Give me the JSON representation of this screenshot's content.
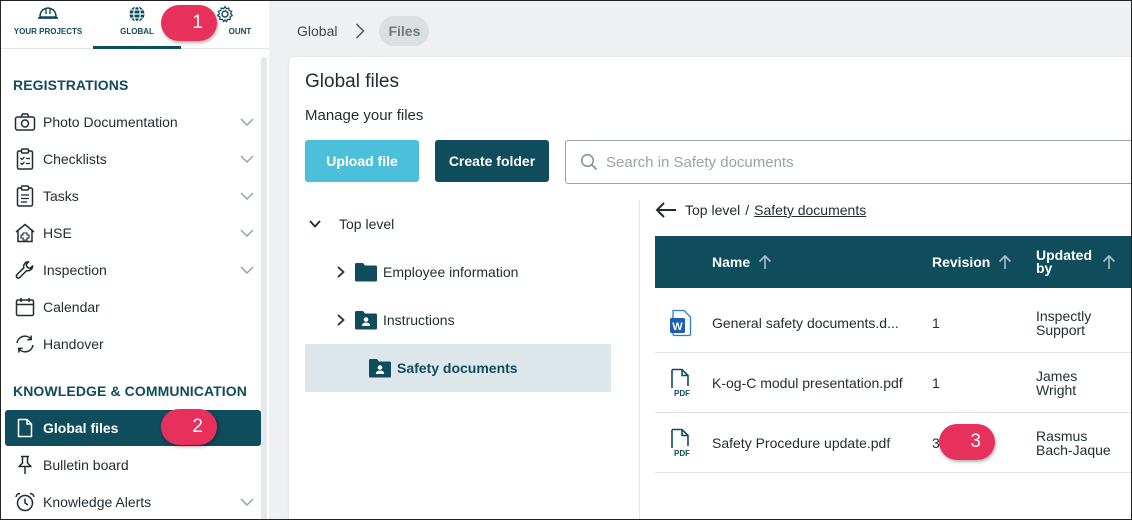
{
  "top_nav": {
    "items": [
      {
        "label": "YOUR PROJECTS",
        "icon": "hard-hat-icon"
      },
      {
        "label": "GLOBAL",
        "icon": "globe-icon",
        "active": true
      },
      {
        "label": "ACCOUNT",
        "icon": "gear-icon",
        "visible_text": "OUNT"
      }
    ]
  },
  "sidebar": {
    "section1_title": "REGISTRATIONS",
    "section1_items": [
      {
        "label": "Photo Documentation",
        "icon": "camera-icon",
        "expandable": true
      },
      {
        "label": "Checklists",
        "icon": "checklist-icon",
        "expandable": true
      },
      {
        "label": "Tasks",
        "icon": "clipboard-icon",
        "expandable": true
      },
      {
        "label": "HSE",
        "icon": "hse-house-icon",
        "expandable": true
      },
      {
        "label": "Inspection",
        "icon": "wrench-icon",
        "expandable": true
      },
      {
        "label": "Calendar",
        "icon": "calendar-icon",
        "expandable": false
      },
      {
        "label": "Handover",
        "icon": "handover-icon",
        "expandable": false
      }
    ],
    "section2_title": "KNOWLEDGE & COMMUNICATION",
    "section2_items": [
      {
        "label": "Global files",
        "icon": "file-icon",
        "active": true
      },
      {
        "label": "Bulletin board",
        "icon": "pin-icon"
      },
      {
        "label": "Knowledge Alerts",
        "icon": "alarm-clock-icon",
        "expandable": true
      }
    ]
  },
  "breadcrumb": {
    "parent": "Global",
    "current": "Files"
  },
  "page": {
    "title": "Global files",
    "subtitle": "Manage your files",
    "upload_label": "Upload file",
    "create_folder_label": "Create folder",
    "search_placeholder": "Search in Safety documents"
  },
  "tree": {
    "root": "Top level",
    "folders": [
      {
        "label": "Employee information",
        "expandable": true
      },
      {
        "label": "Instructions",
        "expandable": true
      },
      {
        "label": "Safety documents",
        "expandable": false,
        "selected": true
      }
    ]
  },
  "path": {
    "root": "Top level",
    "separator": "/",
    "current": "Safety documents"
  },
  "table": {
    "columns": [
      "Name",
      "Revision",
      "Updated by"
    ],
    "header_updated_line1": "Updated",
    "header_updated_line2": "by",
    "rows": [
      {
        "icon": "word-doc-icon",
        "name": "General safety documents.d...",
        "revision": "1",
        "updated_by_1": "Inspectly",
        "updated_by_2": "Support"
      },
      {
        "icon": "pdf-icon",
        "name": "K-og-C modul presentation.pdf",
        "revision": "1",
        "updated_by_1": "James",
        "updated_by_2": "Wright"
      },
      {
        "icon": "pdf-icon",
        "name": "Safety Procedure update.pdf",
        "revision": "3",
        "updated_by_1": "Rasmus",
        "updated_by_2": "Bach-Jaque"
      }
    ]
  },
  "callouts": [
    "1",
    "2",
    "3"
  ],
  "colors": {
    "primary": "#0f4c5c",
    "accent": "#4cc0da",
    "callout": "#e8305c"
  }
}
